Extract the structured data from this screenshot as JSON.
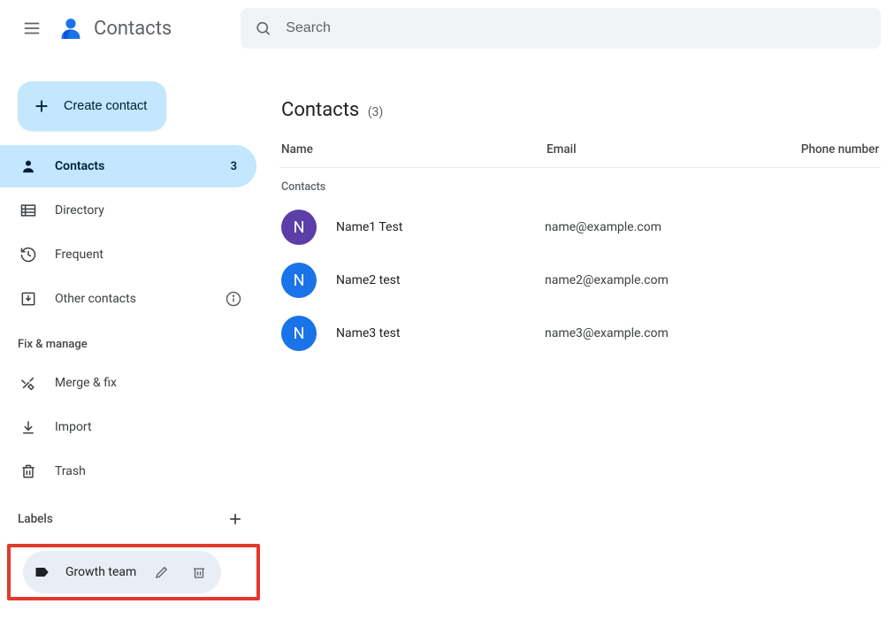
{
  "app": {
    "title": "Contacts"
  },
  "search": {
    "placeholder": "Search"
  },
  "sidebar": {
    "createLabel": "Create contact",
    "items": [
      {
        "label": "Contacts",
        "count": "3"
      },
      {
        "label": "Directory"
      },
      {
        "label": "Frequent"
      },
      {
        "label": "Other contacts"
      }
    ],
    "fixManage": {
      "title": "Fix & manage",
      "items": [
        {
          "label": "Merge & fix"
        },
        {
          "label": "Import"
        },
        {
          "label": "Trash"
        }
      ]
    },
    "labels": {
      "title": "Labels",
      "items": [
        {
          "label": "Growth team"
        }
      ]
    }
  },
  "main": {
    "title": "Contacts",
    "countDisplay": "(3)",
    "columns": {
      "name": "Name",
      "email": "Email",
      "phone": "Phone number"
    },
    "groupLabel": "Contacts",
    "contacts": [
      {
        "initial": "N",
        "avatarColor": "#5c3ea8",
        "name": "Name1 Test",
        "email": "name@example.com"
      },
      {
        "initial": "N",
        "avatarColor": "#1a73e8",
        "name": "Name2 test",
        "email": "name2@example.com"
      },
      {
        "initial": "N",
        "avatarColor": "#1a73e8",
        "name": "Name3 test",
        "email": "name3@example.com"
      }
    ]
  }
}
